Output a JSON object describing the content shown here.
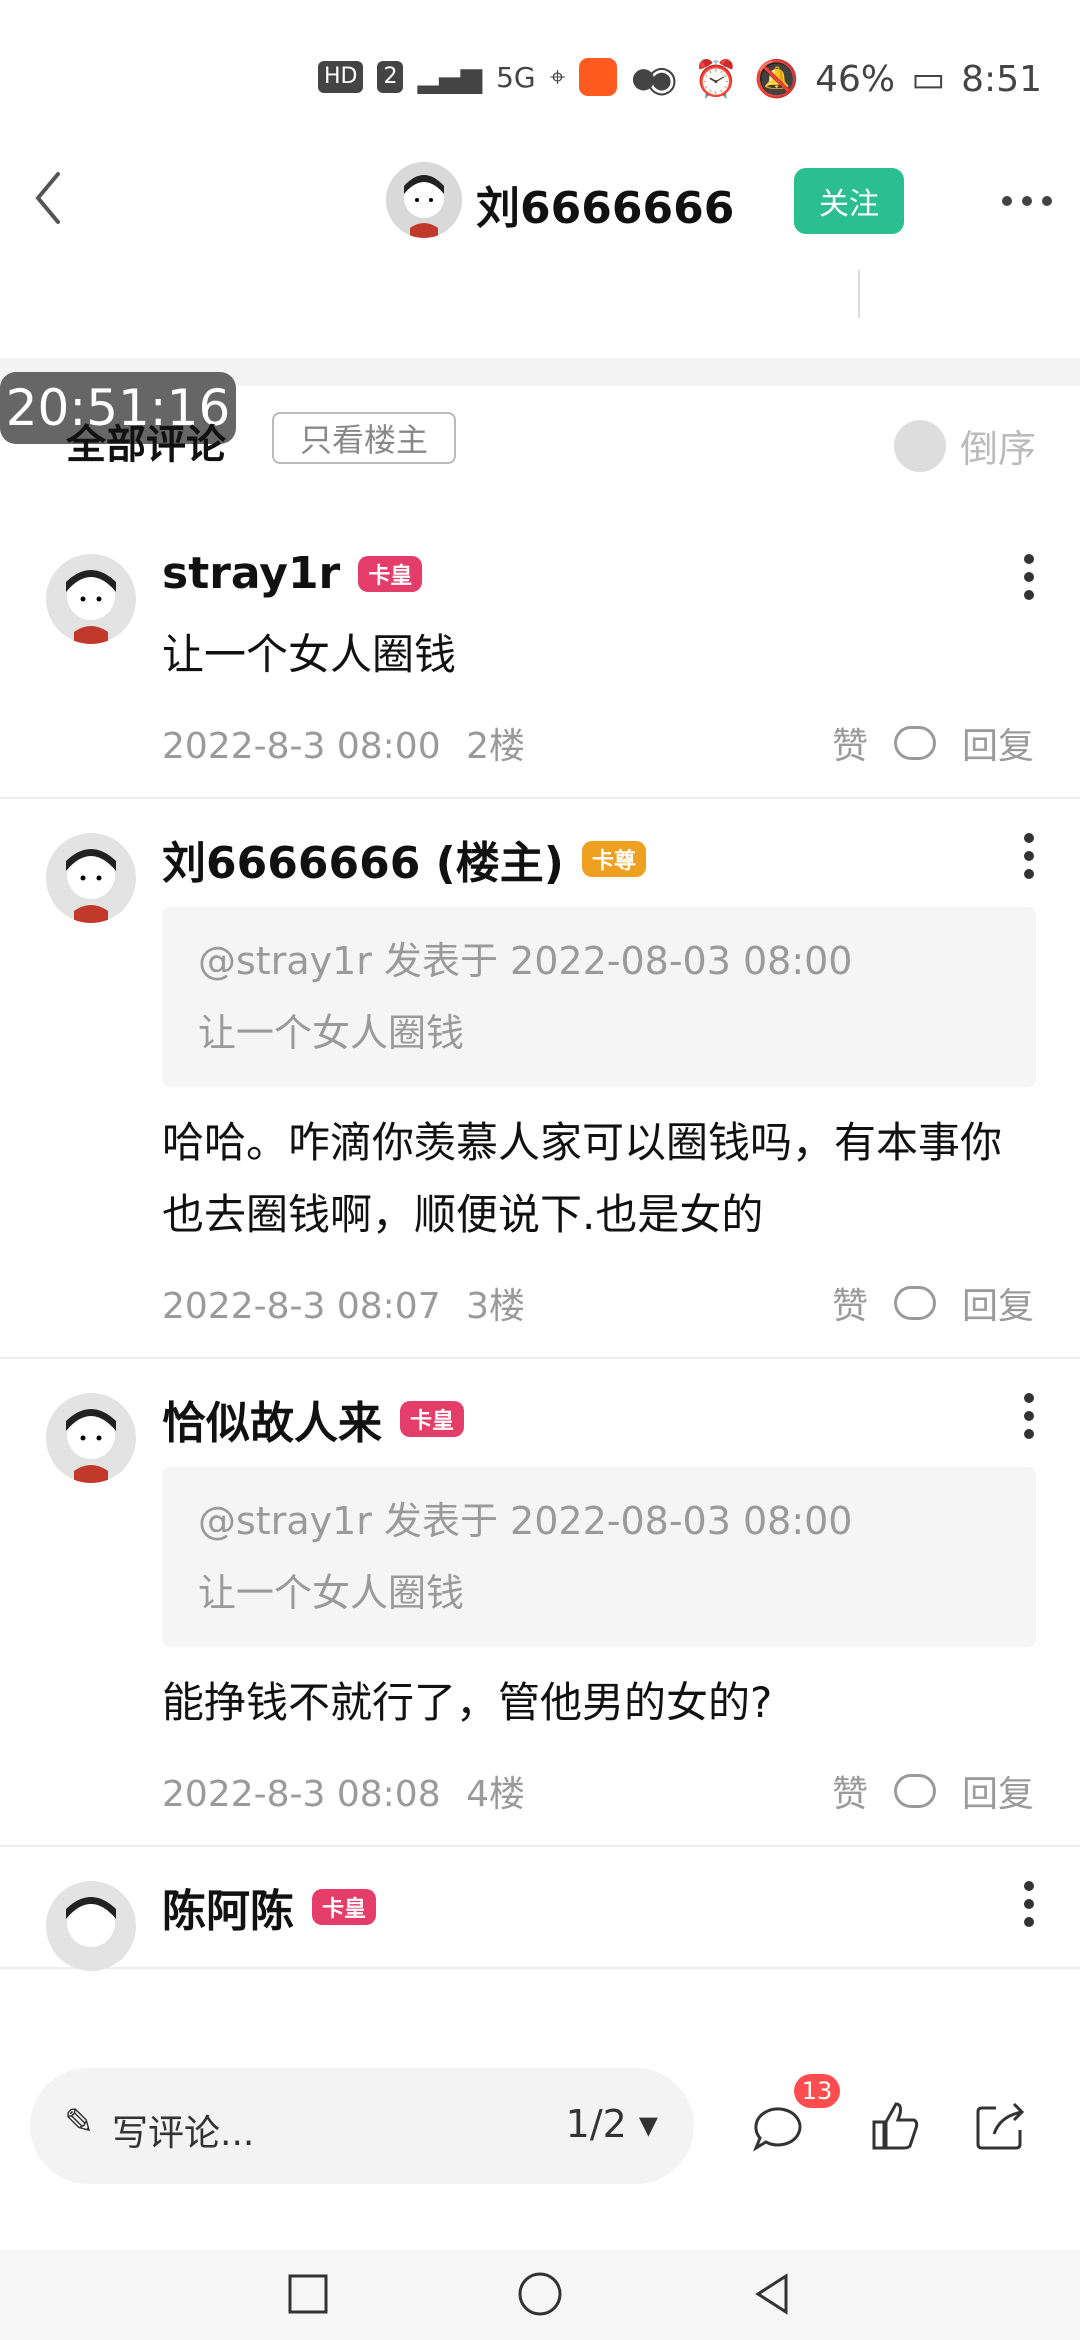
{
  "status": {
    "left_pills": [
      "HD",
      "2"
    ],
    "signal_5g": "5G",
    "battery": "46%",
    "time": "8:51"
  },
  "nav": {
    "username": "刘6666666",
    "follow_label": "关注"
  },
  "overlay": {
    "timestamp": "20:51:16"
  },
  "filter": {
    "all_comments": "全部评论",
    "only_op": "只看楼主",
    "order": "倒序"
  },
  "comments": [
    {
      "name": "stray1r",
      "badge": "卡皇",
      "body": "让一个女人圈钱",
      "date": "2022-8-3 08:00",
      "floor": "2楼",
      "like": "赞",
      "reply": "回复"
    },
    {
      "name": "刘6666666 (楼主)",
      "badge": "卡尊",
      "quote_header": "@stray1r 发表于 2022-08-03 08:00",
      "quote_body": "让一个女人圈钱",
      "body": "哈哈。咋滴你羡慕人家可以圈钱吗，有本事你也去圈钱啊，顺便说下.也是女的",
      "date": "2022-8-3 08:07",
      "floor": "3楼",
      "like": "赞",
      "reply": "回复"
    },
    {
      "name": "恰似故人来",
      "badge": "卡皇",
      "quote_header": "@stray1r 发表于 2022-08-03 08:00",
      "quote_body": "让一个女人圈钱",
      "body": "能挣钱不就行了，管他男的女的?",
      "date": "2022-8-3 08:08",
      "floor": "4楼",
      "like": "赞",
      "reply": "回复"
    },
    {
      "name": "陈阿陈",
      "badge": "卡皇"
    }
  ],
  "bottom": {
    "write_comment": "写评论...",
    "pager": "1/2",
    "comment_count": "13"
  },
  "colors": {
    "accent": "#2bbf8f",
    "badge": "#ff4d4f"
  }
}
